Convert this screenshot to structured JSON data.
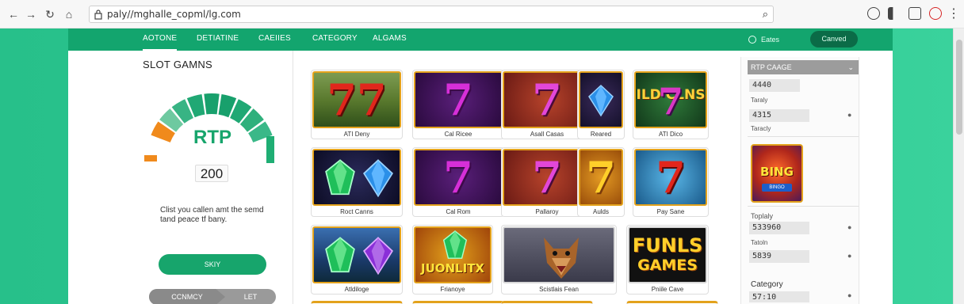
{
  "browser": {
    "url": "paly//mghalle_copml/lg.com"
  },
  "site": {
    "nav": [
      "AOTONE",
      "DETIATINE",
      "CAEIIES",
      "CATEGORY",
      "ALGAMS"
    ],
    "status_label": "Eates",
    "connect_label": "Canved",
    "colors": {
      "primary": "#17a56c",
      "page_bg": "#2dc892",
      "accent_border": "#e3a21c"
    }
  },
  "left": {
    "title": "SLOT GAMNS",
    "gauge_label": "RTP",
    "gauge_value": "200",
    "description": "Clist you callen amt the semd tand peace tf bany.",
    "primary_button": "SKIY",
    "toggle_left": "CCNMCY",
    "toggle_right": "LET"
  },
  "games": [
    {
      "caption": "ATI Deny",
      "art": "sevens"
    },
    {
      "caption": "Cal Ricee",
      "art": "purple-seven"
    },
    {
      "caption": "Asall Casas",
      "art": "purple-seven-red"
    },
    {
      "caption": "Reared",
      "art": "blue-gem"
    },
    {
      "caption": "ATI Dico",
      "art": "gold-casinos"
    },
    {
      "caption": "Roct Canns",
      "art": "gems"
    },
    {
      "caption": "Cal Rom",
      "art": "purple-seven"
    },
    {
      "caption": "Pallaroy",
      "art": "purple-seven-red"
    },
    {
      "caption": "Aulds",
      "art": "gold-seven"
    },
    {
      "caption": "Pay Sane",
      "art": "blue-seven"
    },
    {
      "caption": "Atldiloge",
      "art": "gems-2"
    },
    {
      "caption": "Frianoye",
      "art": "jungle"
    },
    {
      "caption": "Scistlais Fean",
      "art": "wolf"
    },
    {
      "caption": "Pniile Cave",
      "art": "funls"
    }
  ],
  "card_art_text": {
    "gold_casinos": "ILD CLNS",
    "jungle": "JUONLITX",
    "funls_line1": "FUNLS",
    "funls_line2": "GAMES",
    "seven": "7",
    "sevens": "77"
  },
  "right": {
    "header": "RTP CAAGE",
    "fields": [
      {
        "value": "4440",
        "label": "Taraly"
      },
      {
        "value": "4315",
        "label": "Taracly"
      }
    ],
    "promo_title": "BING",
    "promo_sub": "BINGO",
    "fields2": [
      {
        "label": "Toplaly",
        "value": "533960"
      },
      {
        "label": "Tatoln",
        "value": "5839"
      },
      {
        "label": "Category",
        "value": "57:10"
      }
    ]
  }
}
